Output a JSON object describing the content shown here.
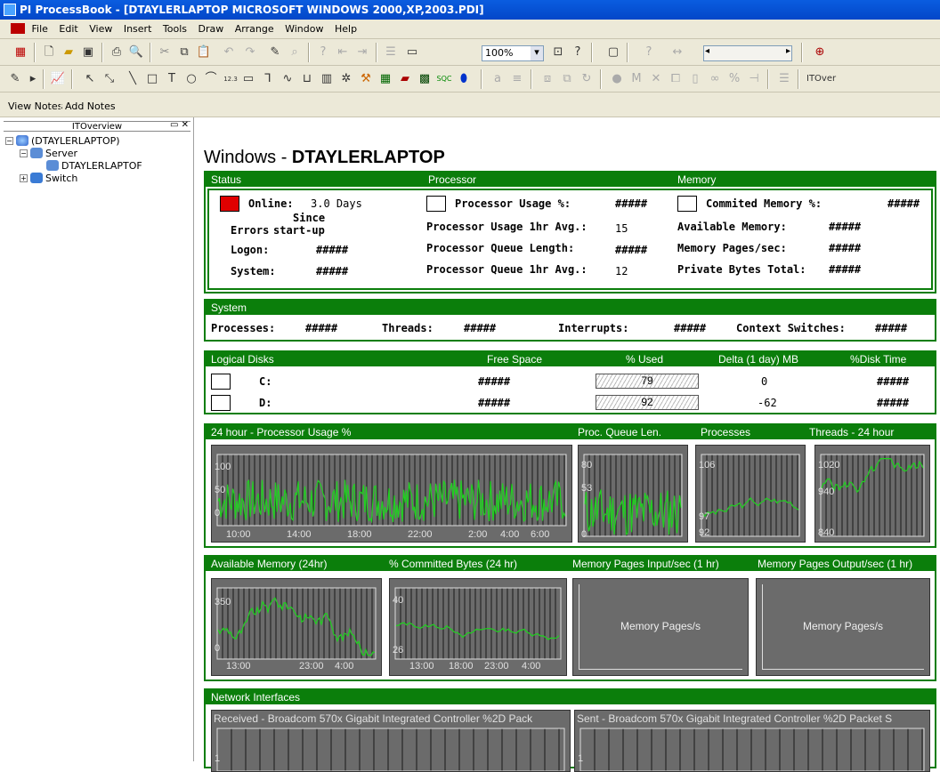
{
  "window": {
    "title": "PI ProcessBook - [DTAYLERLAPTOP MICROSOFT WINDOWS 2000,XP,2003.PDI]"
  },
  "menu": [
    "File",
    "Edit",
    "View",
    "Insert",
    "Tools",
    "Draw",
    "Arrange",
    "Window",
    "Help"
  ],
  "toolbar": {
    "zoom": "100%",
    "text_btn": "a",
    "itover": "ITOver",
    "view_notes": "View Notes",
    "add_notes": "Add Notes",
    "gauge_label": "12.3"
  },
  "tree": {
    "panel_title": "ITOverview",
    "root": "(DTAYLERLAPTOP)",
    "server": "Server",
    "server_child": "DTAYLERLAPTOF",
    "switch": "Switch"
  },
  "page": {
    "title_prefix": "Windows - ",
    "title_host": "DTAYLERLAPTOP"
  },
  "headers": {
    "top": [
      "Status",
      "Processor",
      "Memory"
    ],
    "system": "System",
    "disks": [
      "Logical Disks",
      "Free Space",
      "% Used",
      "Delta (1 day) MB",
      "%Disk Time"
    ],
    "proc_trend": [
      "24 hour - Processor Usage %",
      "Proc. Queue Len.",
      "Processes",
      "Threads - 24 hour"
    ],
    "mem_trend": [
      "Available Memory (24hr)",
      "% Committed Bytes (24 hr)",
      "Memory Pages Input/sec (1 hr)",
      "Memory Pages Output/sec (1 hr)"
    ],
    "network": "Network Interfaces"
  },
  "status": {
    "online_label": "Online:",
    "online_value": "3.0 Days",
    "errors_label": "Errors",
    "since_label": "Since",
    "startup_label": "start-up",
    "logon_label": "Logon:",
    "logon_value": "#####",
    "system_label": "System:",
    "system_value": "#####"
  },
  "processor": {
    "usage_label": "Processor Usage %:",
    "usage_value": "#####",
    "usage_avg_label": "Processor Usage 1hr Avg.:",
    "usage_avg_value": "15",
    "queue_label": "Processor Queue Length:",
    "queue_value": "#####",
    "queue_avg_label": "Processor Queue 1hr Avg.:",
    "queue_avg_value": "12"
  },
  "memory": {
    "committed_label": "Commited Memory %:",
    "committed_value": "#####",
    "available_label": "Available Memory:",
    "available_value": "#####",
    "pages_label": "Memory Pages/sec:",
    "pages_value": "#####",
    "private_label": "Private Bytes Total:",
    "private_value": "#####"
  },
  "system": {
    "processes_label": "Processes:",
    "processes_value": "#####",
    "threads_label": "Threads:",
    "threads_value": "#####",
    "interrupts_label": "Interrupts:",
    "interrupts_value": "#####",
    "ctx_label": "Context Switches:",
    "ctx_value": "#####"
  },
  "disks": [
    {
      "drive": "C:",
      "free": "#####",
      "used": "79",
      "delta": "0",
      "disk_time": "#####"
    },
    {
      "drive": "D:",
      "free": "#####",
      "used": "92",
      "delta": "-62",
      "disk_time": "#####"
    }
  ],
  "trends": {
    "cpu": {
      "ticks_y": [
        "100",
        "50",
        "0"
      ],
      "ticks_x": [
        "10:00",
        "14:00",
        "18:00",
        "22:00",
        "2:00",
        "4:00",
        "6:00"
      ]
    },
    "queue": {
      "ticks_y": [
        "80",
        "53",
        "0"
      ]
    },
    "processes": {
      "ticks_y": [
        "106",
        "97",
        "92"
      ]
    },
    "threads": {
      "ticks_y": [
        "1020",
        "940",
        "840"
      ]
    },
    "avail_mem": {
      "ticks_y": [
        "350",
        "0"
      ],
      "ticks_x": [
        "13:00",
        "23:00",
        "4:00"
      ]
    },
    "committed": {
      "ticks_y": [
        "40",
        "26"
      ],
      "ticks_x": [
        "13:00",
        "18:00",
        "23:00",
        "4:00"
      ]
    },
    "pages_in": {
      "label": "Memory Pages/s"
    },
    "pages_out": {
      "label": "Memory Pages/s"
    },
    "net_recv": {
      "title": "Received - Broadcom 570x Gigabit Integrated Controller %2D Pack",
      "tick": "1"
    },
    "net_sent": {
      "title": "Sent - Broadcom 570x Gigabit Integrated Controller %2D Packet S",
      "tick": "1"
    }
  },
  "colors": {
    "section_green": "#0b7e0b",
    "trend_line": "#1fd11f",
    "trend_bg": "#6b6b6b",
    "offline_red": "#e00000"
  }
}
